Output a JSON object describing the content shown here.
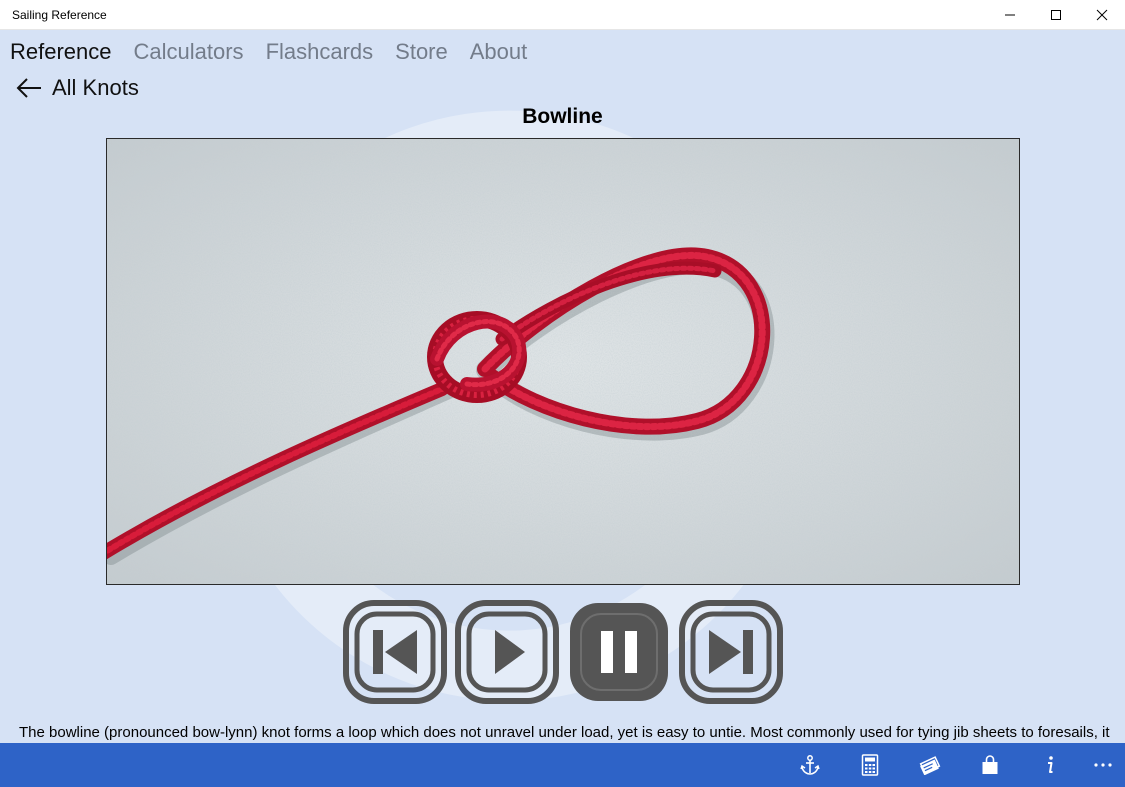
{
  "window": {
    "title": "Sailing Reference"
  },
  "nav": {
    "items": [
      {
        "label": "Reference",
        "active": true
      },
      {
        "label": "Calculators",
        "active": false
      },
      {
        "label": "Flashcards",
        "active": false
      },
      {
        "label": "Store",
        "active": false
      },
      {
        "label": "About",
        "active": false
      }
    ]
  },
  "back": {
    "label": "All Knots"
  },
  "knot": {
    "title": "Bowline",
    "description": "The bowline (pronounced bow-lynn) knot forms a loop which does not unravel under load, yet is easy to untie. Most commonly used for tying jib sheets to foresails, it can"
  },
  "player": {
    "buttons": [
      "previous-step",
      "play",
      "pause",
      "next-step"
    ],
    "active": "pause"
  },
  "appbar": {
    "icons": [
      "anchor-icon",
      "calculator-icon",
      "flashcard-icon",
      "store-bag-icon",
      "info-icon",
      "more-icon"
    ]
  },
  "colors": {
    "background": "#d6e2f5",
    "appbar": "#2e63c7",
    "rope": "#c8102e",
    "control": "#555555"
  }
}
